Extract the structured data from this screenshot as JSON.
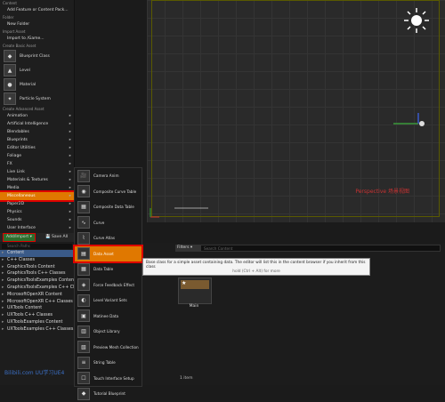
{
  "viewport": {
    "overlay_text": "Perspective 场景视图"
  },
  "menu": {
    "content_header": "Content",
    "add_feature": "Add Feature or Content Pack...",
    "folder_header": "Folder",
    "new_folder": "New Folder",
    "import_header": "Import Asset",
    "import_game": "Import to /Game...",
    "basic_header": "Create Basic Asset",
    "basic_items": [
      "Blueprint Class",
      "Level",
      "Material",
      "Particle System"
    ],
    "advanced_header": "Create Advanced Asset",
    "advanced_items": [
      "Animation",
      "Artificial Intelligence",
      "Blendables",
      "Blueprints",
      "Editor Utilities",
      "Foliage",
      "FX",
      "Live Link",
      "Materials & Textures",
      "Media",
      "Miscellaneous",
      "Paper2D",
      "Physics",
      "Sounds",
      "User Interface"
    ]
  },
  "submenu": {
    "items": [
      "Camera Anim",
      "Composite Curve Table",
      "Composite Data Table",
      "Curve",
      "Curve Atlas",
      "Data Asset",
      "Data Table",
      "Force Feedback Effect",
      "Level Variant Sets",
      "Matinee Data",
      "Object Library",
      "Preview Mesh Collection",
      "String Table",
      "Touch Interface Setup",
      "Tutorial Blueprint"
    ]
  },
  "tooltip": {
    "text": "Base class for a simple asset containing data. The editor will list this in the content browser if you inherit from this class",
    "hint": "hold (Ctrl + Alt) for more"
  },
  "toolbar": {
    "add_import": "Add/Import ▾",
    "save_all": "Save All"
  },
  "content_browser": {
    "search_paths_placeholder": "Search Paths",
    "tree": [
      "Content",
      "C++ Classes",
      "GraphicsTools Content",
      "GraphicsTools C++ Classes",
      "GraphicsToolsExamples Content",
      "GraphicsToolsExamples C++ Classes",
      "MicrosoftOpenXR Content",
      "MicrosoftOpenXR C++ Classes",
      "UXTools Content",
      "UXTools C++ Classes",
      "UXToolsExamples Content",
      "UXToolsExamples C++ Classes"
    ],
    "filters_label": "Filters ▾",
    "search_placeholder": "Search Content",
    "asset_name": "Main",
    "items_count": "1 item"
  },
  "watermark": "Bilibili.com  UU学习UE4"
}
